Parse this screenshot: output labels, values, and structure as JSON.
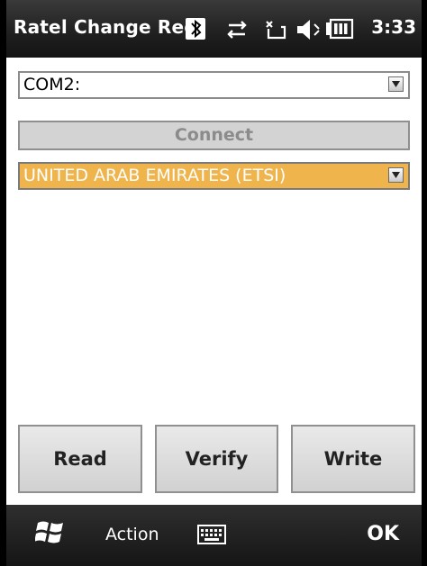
{
  "window": {
    "title": "Ratel Change Regi"
  },
  "status": {
    "time": "3:33",
    "icons": [
      "bluetooth-icon",
      "connectivity-icon",
      "call-icon",
      "volume-muted-icon",
      "battery-icon"
    ]
  },
  "port_select": {
    "value": "COM2:"
  },
  "connect_button": {
    "label": "Connect"
  },
  "region_select": {
    "value": "UNITED ARAB EMIRATES (ETSI)"
  },
  "actions": {
    "read": "Read",
    "verify": "Verify",
    "write": "Write"
  },
  "bottom": {
    "start_icon": "windows-start-icon",
    "action": "Action",
    "keyboard_icon": "keyboard-icon",
    "ok": "OK"
  },
  "colors": {
    "selection": "#f0b44c",
    "statusbar": "#1f1f1f",
    "button": "#dcdcdc"
  }
}
